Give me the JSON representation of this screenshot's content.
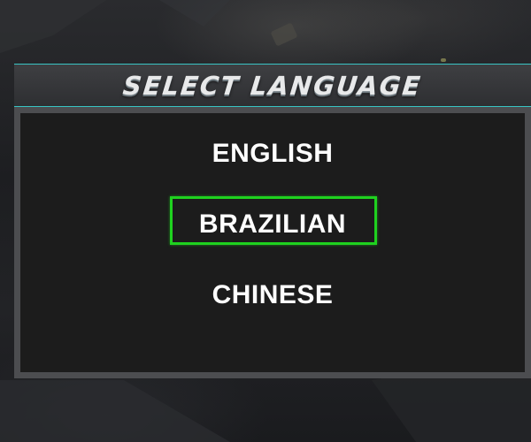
{
  "dialog": {
    "title": "SELECT LANGUAGE",
    "options": [
      {
        "label": "ENGLISH",
        "selected": false
      },
      {
        "label": "BRAZILIAN",
        "selected": true
      },
      {
        "label": "CHINESE",
        "selected": false
      }
    ]
  },
  "colors": {
    "accent_border": "#38c4c4",
    "selection_highlight": "#1fd21f",
    "option_text": "#ffffff",
    "body_background": "#1c1c1c"
  }
}
